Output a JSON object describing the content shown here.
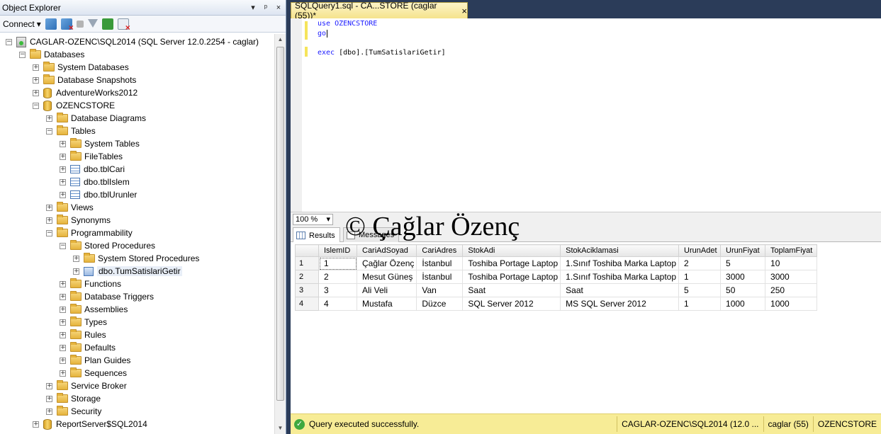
{
  "object_explorer": {
    "title": "Object Explorer",
    "title_buttons": [
      "▾",
      "ᵖ",
      "×"
    ],
    "connect_label": "Connect",
    "connect_arrow": "▾",
    "scroll_up": "▲",
    "scroll_down": "▼",
    "tree": [
      {
        "id": "server",
        "label": "CAGLAR-OZENC\\SQL2014 (SQL Server 12.0.2254 - caglar)",
        "icon": "server-icon",
        "expander": "−"
      },
      {
        "id": "databases",
        "label": "Databases",
        "icon": "folder-icon",
        "expander": "−"
      },
      {
        "id": "system-databases",
        "label": "System Databases",
        "icon": "folder-icon",
        "expander": "+"
      },
      {
        "id": "database-snapshots",
        "label": "Database Snapshots",
        "icon": "folder-icon",
        "expander": "+"
      },
      {
        "id": "adventureworks2012",
        "label": "AdventureWorks2012",
        "icon": "database-icon",
        "expander": "+"
      },
      {
        "id": "ozencstore",
        "label": "OZENCSTORE",
        "icon": "database-icon",
        "expander": "−"
      },
      {
        "id": "database-diagrams",
        "label": "Database Diagrams",
        "icon": "folder-icon",
        "expander": "+"
      },
      {
        "id": "tables",
        "label": "Tables",
        "icon": "folder-icon",
        "expander": "−"
      },
      {
        "id": "system-tables",
        "label": "System Tables",
        "icon": "folder-icon",
        "expander": "+"
      },
      {
        "id": "filetables",
        "label": "FileTables",
        "icon": "folder-icon",
        "expander": "+"
      },
      {
        "id": "tblcari",
        "label": "dbo.tblCari",
        "icon": "table-icon",
        "expander": "+"
      },
      {
        "id": "tblislem",
        "label": "dbo.tblIslem",
        "icon": "table-icon",
        "expander": "+"
      },
      {
        "id": "tblurunler",
        "label": "dbo.tblUrunler",
        "icon": "table-icon",
        "expander": "+"
      },
      {
        "id": "views",
        "label": "Views",
        "icon": "folder-icon",
        "expander": "+"
      },
      {
        "id": "synonyms",
        "label": "Synonyms",
        "icon": "folder-icon",
        "expander": "+"
      },
      {
        "id": "programmability",
        "label": "Programmability",
        "icon": "folder-icon",
        "expander": "−"
      },
      {
        "id": "stored-procedures",
        "label": "Stored Procedures",
        "icon": "folder-icon",
        "expander": "−"
      },
      {
        "id": "system-stored-procedures",
        "label": "System Stored Procedures",
        "icon": "folder-icon",
        "expander": "+"
      },
      {
        "id": "tumsatislarigetir",
        "label": "dbo.TumSatislariGetir",
        "icon": "procedure-icon",
        "expander": "+"
      },
      {
        "id": "functions",
        "label": "Functions",
        "icon": "folder-icon",
        "expander": "+"
      },
      {
        "id": "database-triggers",
        "label": "Database Triggers",
        "icon": "folder-icon",
        "expander": "+"
      },
      {
        "id": "assemblies",
        "label": "Assemblies",
        "icon": "folder-icon",
        "expander": "+"
      },
      {
        "id": "types",
        "label": "Types",
        "icon": "folder-icon",
        "expander": "+"
      },
      {
        "id": "rules",
        "label": "Rules",
        "icon": "folder-icon",
        "expander": "+"
      },
      {
        "id": "defaults",
        "label": "Defaults",
        "icon": "folder-icon",
        "expander": "+"
      },
      {
        "id": "plan-guides",
        "label": "Plan Guides",
        "icon": "folder-icon",
        "expander": "+"
      },
      {
        "id": "sequences",
        "label": "Sequences",
        "icon": "folder-icon",
        "expander": "+"
      },
      {
        "id": "service-broker",
        "label": "Service Broker",
        "icon": "folder-icon",
        "expander": "+"
      },
      {
        "id": "storage",
        "label": "Storage",
        "icon": "folder-icon",
        "expander": "+"
      },
      {
        "id": "security",
        "label": "Security",
        "icon": "folder-icon",
        "expander": "+"
      },
      {
        "id": "reportserver",
        "label": "ReportServer$SQL2014",
        "icon": "database-icon",
        "expander": "+"
      }
    ]
  },
  "editor": {
    "tab_title": "SQLQuery1.sql - CA...STORE (caglar (55))*",
    "tab_close": "×",
    "code": {
      "line1_kw": "use",
      "line1_rest": " OZENCSTORE",
      "line2": "go",
      "line4_kw": "exec",
      "line4_rest": " [dbo].[TumSatislariGetir]"
    },
    "zoom": "100 %",
    "zoom_arrow": "▾"
  },
  "results": {
    "tabs": [
      "Results",
      "Messages"
    ],
    "watermark": "© Çağlar Özenç",
    "columns": [
      "IslemID",
      "CariAdSoyad",
      "CariAdres",
      "StokAdi",
      "StokAciklamasi",
      "UrunAdet",
      "UrunFiyat",
      "ToplamFiyat"
    ],
    "rows": [
      {
        "n": "1",
        "cells": [
          "1",
          "Çağlar Özenç",
          "İstanbul",
          "Toshiba Portage Laptop",
          "1.Sınıf Toshiba Marka Laptop",
          "2",
          "5",
          "10"
        ]
      },
      {
        "n": "2",
        "cells": [
          "2",
          "Mesut Güneş",
          "İstanbul",
          "Toshiba Portage Laptop",
          "1.Sınıf Toshiba Marka Laptop",
          "1",
          "3000",
          "3000"
        ]
      },
      {
        "n": "3",
        "cells": [
          "3",
          "Ali Veli",
          "Van",
          "Saat",
          "Saat",
          "5",
          "50",
          "250"
        ]
      },
      {
        "n": "4",
        "cells": [
          "4",
          "Mustafa",
          "Düzce",
          "SQL Server 2012",
          "MS SQL Server 2012",
          "1",
          "1000",
          "1000"
        ]
      }
    ]
  },
  "status": {
    "icon": "✓",
    "message": "Query executed successfully.",
    "server": "CAGLAR-OZENC\\SQL2014 (12.0 ...",
    "user": "caglar (55)",
    "database": "OZENCSTORE"
  }
}
